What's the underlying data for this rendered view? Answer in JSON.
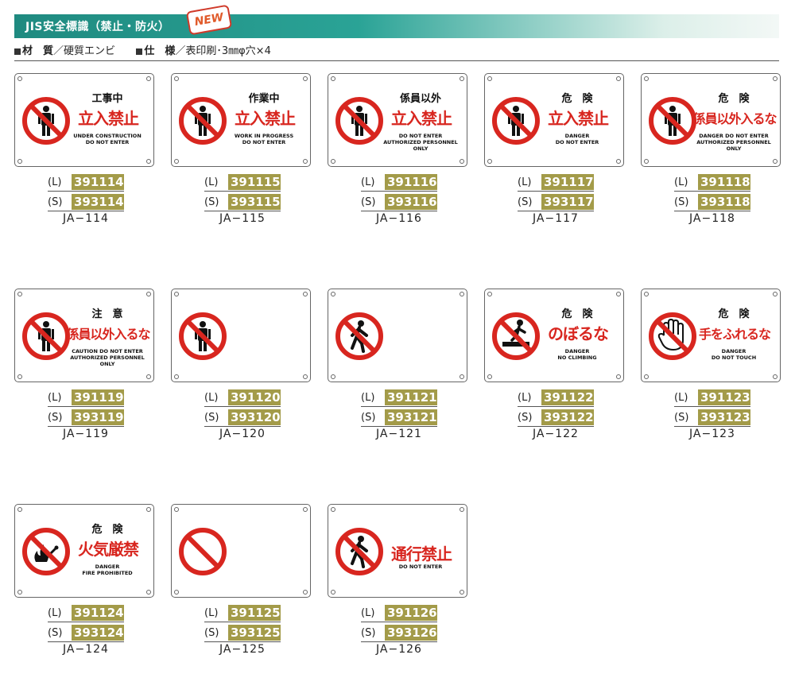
{
  "header": {
    "title": "JIS安全標識（禁止・防火）",
    "badge": "NEW"
  },
  "spec": {
    "material_label": "材　質",
    "material_value": "／硬質エンビ",
    "spec_label": "仕　様",
    "spec_value": "／表印刷･3㎜φ穴×4"
  },
  "colors": {
    "header_teal": "#1f8a80",
    "code_olive": "#a39b49",
    "sign_red": "#d8261f"
  },
  "labels": {
    "large": "(L)",
    "small": "(S)"
  },
  "signs": [
    {
      "symbol": "person",
      "line1": "工事中",
      "line2": "立入禁止",
      "line3": "UNDER CONSTRUCTION\nDO NOT ENTER",
      "code_l": "391114",
      "code_s": "393114",
      "model": "JA−114"
    },
    {
      "symbol": "person",
      "line1": "作業中",
      "line2": "立入禁止",
      "line3": "WORK IN PROGRESS\nDO NOT ENTER",
      "code_l": "391115",
      "code_s": "393115",
      "model": "JA−115"
    },
    {
      "symbol": "person",
      "line1": "係員以外",
      "line2": "立入禁止",
      "line3": "DO NOT ENTER\nAUTHORIZED PERSONNEL ONLY",
      "code_l": "391116",
      "code_s": "393116",
      "model": "JA−116"
    },
    {
      "symbol": "person",
      "line1": "危　険",
      "line2": "立入禁止",
      "line3": "DANGER\nDO NOT ENTER",
      "code_l": "391117",
      "code_s": "393117",
      "model": "JA−117"
    },
    {
      "symbol": "person",
      "line1": "危　険",
      "line2": "係員以外入るな",
      "line3": "DANGER  DO NOT ENTER\nAUTHORIZED PERSONNEL ONLY",
      "code_l": "391118",
      "code_s": "393118",
      "model": "JA−118"
    },
    {
      "symbol": "person",
      "line1": "注　意",
      "line2": "係員以外入るな",
      "line3": "CAUTION  DO NOT ENTER\nAUTHORIZED PERSONNEL ONLY",
      "code_l": "391119",
      "code_s": "393119",
      "model": "JA−119"
    },
    {
      "symbol": "person",
      "line1": "",
      "line2": "",
      "line3": "",
      "code_l": "391120",
      "code_s": "393120",
      "model": "JA−120"
    },
    {
      "symbol": "walker",
      "line1": "",
      "line2": "",
      "line3": "",
      "code_l": "391121",
      "code_s": "393121",
      "model": "JA−121"
    },
    {
      "symbol": "climber",
      "line1": "危　険",
      "line2": "のぼるな",
      "line3": "DANGER\nNO CLIMBING",
      "code_l": "391122",
      "code_s": "393122",
      "model": "JA−122"
    },
    {
      "symbol": "hand",
      "line1": "危　険",
      "line2": "手をふれるな",
      "line3": "DANGER\nDO NOT TOUCH",
      "code_l": "391123",
      "code_s": "393123",
      "model": "JA−123"
    },
    {
      "symbol": "fire",
      "line1": "危　険",
      "line2": "火気厳禁",
      "line3": "DANGER\nFIRE PROHIBITED",
      "code_l": "391124",
      "code_s": "393124",
      "model": "JA−124"
    },
    {
      "symbol": "blank",
      "line1": "",
      "line2": "",
      "line3": "",
      "code_l": "391125",
      "code_s": "393125",
      "model": "JA−125"
    },
    {
      "symbol": "walker",
      "line1": "",
      "line2": "通行禁止",
      "line3": "DO NOT ENTER",
      "code_l": "391126",
      "code_s": "393126",
      "model": "JA−126"
    }
  ]
}
